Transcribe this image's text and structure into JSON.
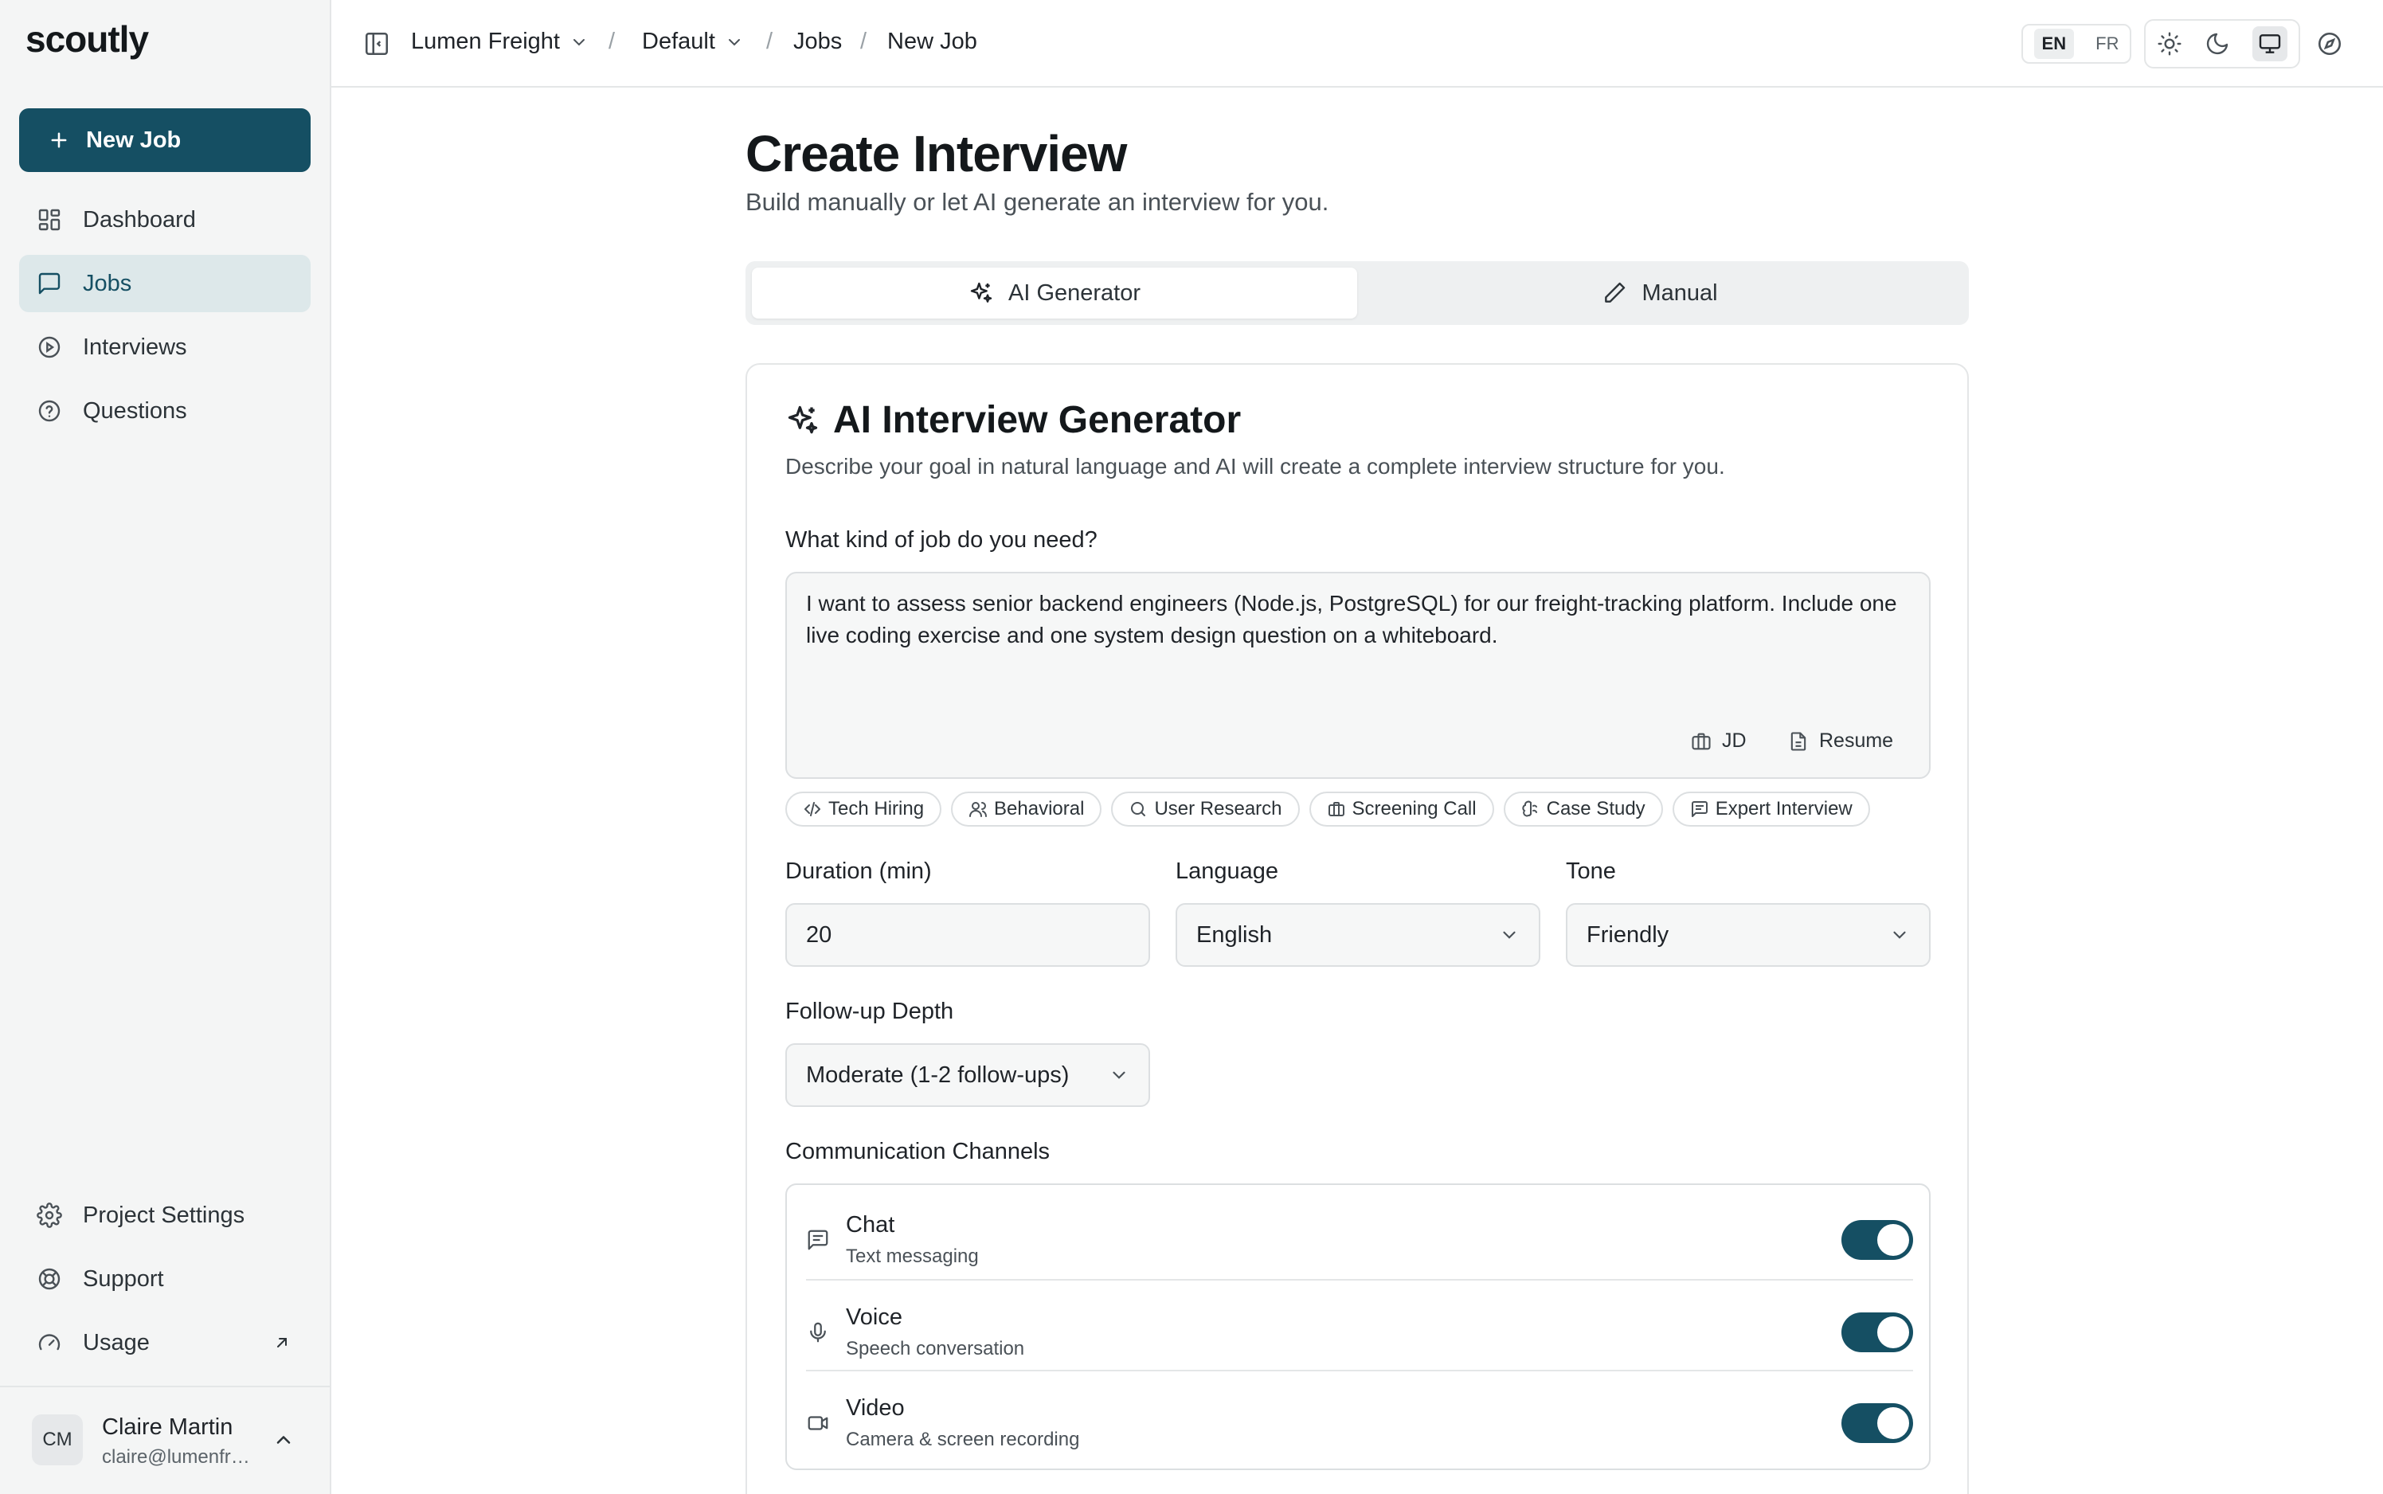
{
  "app": {
    "logo": "scoutly"
  },
  "sidebar": {
    "new_job_label": "New Job",
    "items": [
      {
        "label": "Dashboard",
        "icon": "dashboard-icon"
      },
      {
        "label": "Jobs",
        "icon": "message-square-icon",
        "active": true
      },
      {
        "label": "Interviews",
        "icon": "play-circle-icon"
      },
      {
        "label": "Questions",
        "icon": "help-circle-icon"
      }
    ],
    "bottom_items": [
      {
        "label": "Project Settings",
        "icon": "gear-icon"
      },
      {
        "label": "Support",
        "icon": "lifebuoy-icon"
      },
      {
        "label": "Usage",
        "icon": "gauge-icon"
      }
    ],
    "user": {
      "initials": "CM",
      "name": "Claire Martin",
      "email": "claire@lumenfreight.com"
    }
  },
  "topbar": {
    "breadcrumb": [
      "Lumen Freight",
      "Default",
      "Jobs",
      "New Job"
    ],
    "languages": [
      "EN",
      "FR"
    ],
    "active_language": "EN",
    "theme_modes": [
      "light",
      "dark",
      "system"
    ],
    "active_theme": "system"
  },
  "page": {
    "title": "Create Interview",
    "subtitle": "Build manually or let AI generate an interview for you."
  },
  "tabs": [
    {
      "label": "AI Generator",
      "icon": "sparkles-icon",
      "active": true
    },
    {
      "label": "Manual",
      "icon": "pencil-icon",
      "active": false
    }
  ],
  "generator": {
    "title": "AI Interview Generator",
    "description": "Describe your goal in natural language and AI will create a complete interview structure for you.",
    "prompt_label": "What kind of job do you need?",
    "prompt_value": "I want to assess senior backend engineers (Node.js, PostgreSQL) for our freight-tracking platform. Include one live coding exercise and one system design question on a whiteboard.",
    "attach_jd_label": "JD",
    "attach_resume_label": "Resume",
    "presets": [
      {
        "label": "Tech Hiring",
        "icon": "code-icon"
      },
      {
        "label": "Behavioral",
        "icon": "users-icon"
      },
      {
        "label": "User Research",
        "icon": "search-icon"
      },
      {
        "label": "Screening Call",
        "icon": "briefcase-icon"
      },
      {
        "label": "Case Study",
        "icon": "brain-icon"
      },
      {
        "label": "Expert Interview",
        "icon": "message-lines-icon"
      }
    ],
    "duration_label": "Duration (min)",
    "duration_value": "20",
    "language_label": "Language",
    "language_value": "English",
    "tone_label": "Tone",
    "tone_value": "Friendly",
    "followup_label": "Follow-up Depth",
    "followup_value": "Moderate (1-2 follow-ups)",
    "channels_label": "Communication Channels",
    "channels": [
      {
        "name": "Chat",
        "desc": "Text messaging",
        "icon": "chat-icon",
        "enabled": true
      },
      {
        "name": "Voice",
        "desc": "Speech conversation",
        "icon": "mic-icon",
        "enabled": true
      },
      {
        "name": "Video",
        "desc": "Camera & screen recording",
        "icon": "video-icon",
        "enabled": true
      }
    ]
  },
  "colors": {
    "brand": "#154f63",
    "active_nav_bg": "#dde8ea"
  }
}
